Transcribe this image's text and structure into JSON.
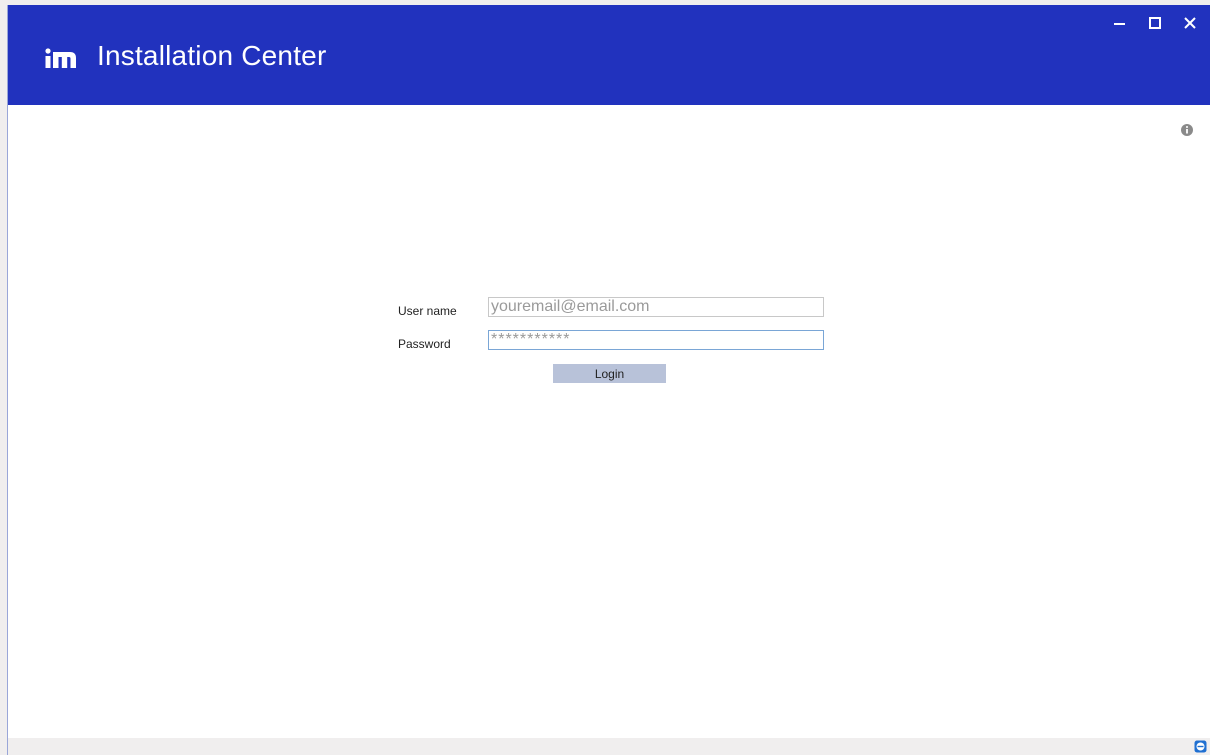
{
  "app": {
    "title": "Installation Center",
    "logo_icon": "m-logo-icon",
    "brand_color": "#2132be"
  },
  "window_controls": {
    "minimize_icon": "minimize-icon",
    "maximize_icon": "maximize-icon",
    "close_icon": "close-icon"
  },
  "info": {
    "icon": "info-icon"
  },
  "login_form": {
    "username_label": "User name",
    "username_placeholder": "youremail@email.com",
    "password_label": "Password",
    "password_placeholder": "***********",
    "login_label": "Login"
  },
  "status_bar": {
    "icon": "remote-session-icon",
    "icon_color": "#1f6fd1"
  }
}
